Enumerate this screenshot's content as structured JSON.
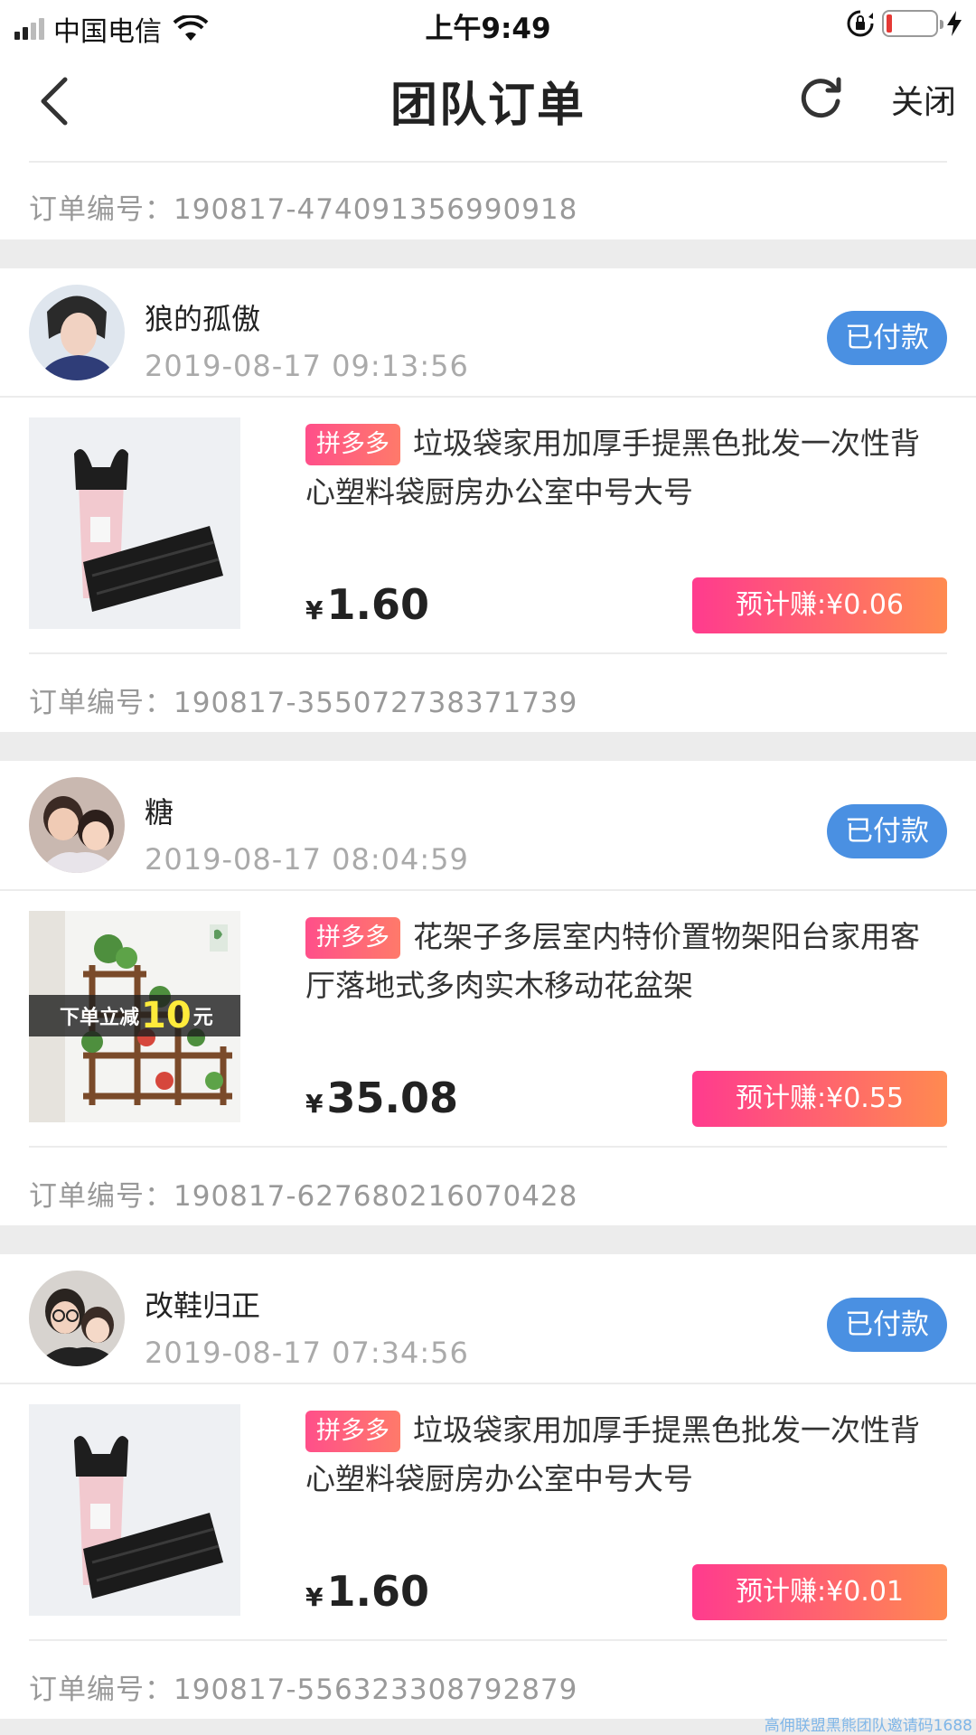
{
  "status_bar": {
    "carrier": "中国电信",
    "time": "上午9:49"
  },
  "nav": {
    "title": "团队订单",
    "close_label": "关闭"
  },
  "orders": [
    {
      "order_no": "订单编号：190817-474091356990918"
    },
    {
      "user": "狼的孤傲",
      "time": "2019-08-17 09:13:56",
      "status": "已付款",
      "platform": "拼多多",
      "title": "垃圾袋家用加厚手提黑色批发一次性背心塑料袋厨房办公室中号大号",
      "currency": "¥",
      "price": "1.60",
      "earn": "预计赚:¥0.06",
      "order_no": "订单编号：190817-355072738371739",
      "image": "trash-bags-image"
    },
    {
      "user": "糖",
      "time": "2019-08-17 08:04:59",
      "status": "已付款",
      "platform": "拼多多",
      "title": "花架子多层室内特价置物架阳台家用客厅落地式多肉实木移动花盆架",
      "currency": "¥",
      "price": "35.08",
      "earn": "预计赚:¥0.55",
      "order_no": "订单编号：190817-627680216070428",
      "image": "flower-rack-image",
      "image_overlay_prefix": "下单立减",
      "image_overlay_number": "10",
      "image_overlay_suffix": "元"
    },
    {
      "user": "改鞋归正",
      "time": "2019-08-17 07:34:56",
      "status": "已付款",
      "platform": "拼多多",
      "title": "垃圾袋家用加厚手提黑色批发一次性背心塑料袋厨房办公室中号大号",
      "currency": "¥",
      "price": "1.60",
      "earn": "预计赚:¥0.01",
      "order_no": "订单编号：190817-556323308792879",
      "image": "trash-bags-image"
    }
  ],
  "watermark": "高佣联盟黑熊团队邀请码1688",
  "colors": {
    "badge_blue": "#4a90e2",
    "earn_gradient_start": "#ff3b8e",
    "earn_gradient_end": "#ff8a50",
    "gap_gray": "#ececec"
  }
}
